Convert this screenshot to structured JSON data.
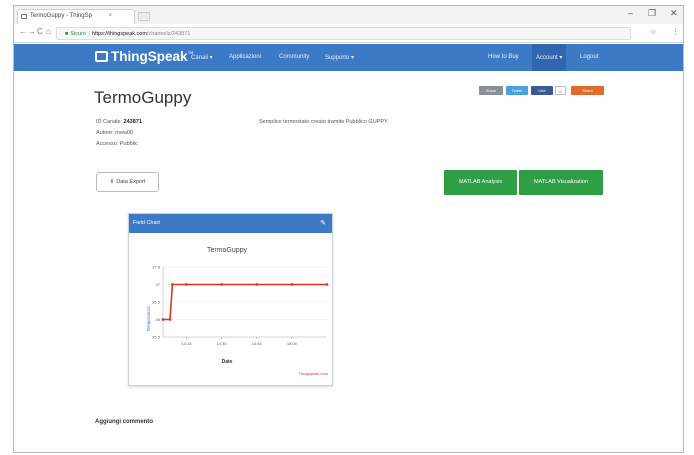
{
  "browser": {
    "tab_title": "TermoGuppy - ThingSp",
    "tab_close": "×",
    "window_controls": [
      "–",
      "❐",
      "✕"
    ],
    "nav_buttons": [
      "←",
      "→",
      "C",
      "⌂"
    ],
    "security_label": "Sicuro",
    "url_host": "https://thingspeak.com",
    "url_path": "/channels/243871",
    "addr_icons": [
      "☆",
      "⋮"
    ]
  },
  "site_nav": {
    "brand": "ThingSpeak",
    "brand_tm": "™",
    "items": [
      "Canali ▾",
      "Applicazioni",
      "Community",
      "Supporto ▾"
    ],
    "right_items": [
      "How to Buy",
      "Account ▾",
      "Logout"
    ]
  },
  "share": {
    "buttons": [
      "Share",
      "Tweet",
      "Like",
      "0",
      "Share"
    ]
  },
  "channel": {
    "title": "TermoGuppy",
    "id_label": "ID Canale:",
    "id_value": "243871",
    "author_label": "Autore:",
    "author_value": "mwa00",
    "access": "Accesso: Pubblic",
    "description": "Semplice termostato creato tramite Pubblico GUPPY."
  },
  "buttons": {
    "data_export": "Data Export",
    "matlab_analysis": "MATLAB Analysis",
    "matlab_visualization": "MATLAB Visualization"
  },
  "widget": {
    "header": "Field Chart",
    "edit_icon": "✎"
  },
  "chart_data": {
    "type": "line",
    "title": "TermoGuppy",
    "xlabel": "Date",
    "ylabel": "Temperatura",
    "y_ticks": [
      "27.5",
      "27",
      "26.5",
      "26",
      "25.5"
    ],
    "x_ticks": [
      "14:15",
      "14:30",
      "14:45",
      "15:00"
    ],
    "ylim": [
      25.5,
      27.5
    ],
    "series": [
      {
        "color": "#d9381e",
        "x": [
          "14:05",
          "14:08",
          "14:09",
          "14:15",
          "14:30",
          "14:45",
          "15:00",
          "15:15"
        ],
        "y": [
          26,
          26,
          27,
          27,
          27,
          27,
          27,
          27
        ]
      }
    ],
    "credit": "Thingspeak.com"
  },
  "comments": {
    "heading": "Aggiungi commento"
  },
  "colors": {
    "nav_blue": "#3c7ac6",
    "green": "#2e9f44",
    "line_red": "#d9381e"
  }
}
